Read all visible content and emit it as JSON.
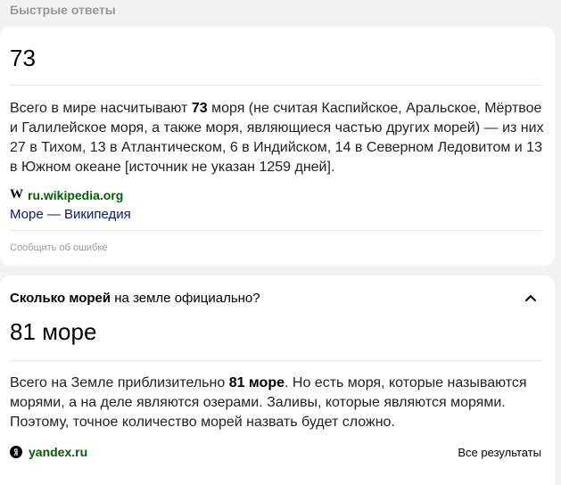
{
  "section": {
    "title": "Быстрые ответы"
  },
  "answer1": {
    "value": "73",
    "text_before": "Всего в мире насчитывают ",
    "text_bold": "73",
    "text_after": " моря (не считая Каспийское, Аральское, Мёртвое и Галилейское моря, а также моря, являющиеся частью других морей) — из них 27 в Тихом, 13 в Атлантическом, 6 в Индийском, 14 в Северном Ледовитом и 13 в Южном океане [источник не указан 1259 дней].",
    "source_icon": "wikipedia-icon",
    "source_icon_glyph": "W",
    "source_domain": "ru.wikipedia.org",
    "source_title": "Море — Википедия",
    "report_label": "Сообщить об ошибке"
  },
  "answer2": {
    "question_bold": "Сколько морей",
    "question_rest": " на земле официально?",
    "value": "81 море",
    "text_before": "Всего на Земле приблизительно ",
    "text_bold": "81 море",
    "text_after": ". Но есть моря, которые называются морями, а на деле являются озерами. Заливы, которые являются морями. Поэтому, точное количество морей назвать будет сложно.",
    "source_icon": "yandex-icon",
    "source_domain": "yandex.ru",
    "all_results_label": "Все результаты"
  },
  "colors": {
    "background": "#f2f2f4",
    "source_green": "#006000",
    "link_blue": "#001a80",
    "muted_gray": "#999999"
  }
}
